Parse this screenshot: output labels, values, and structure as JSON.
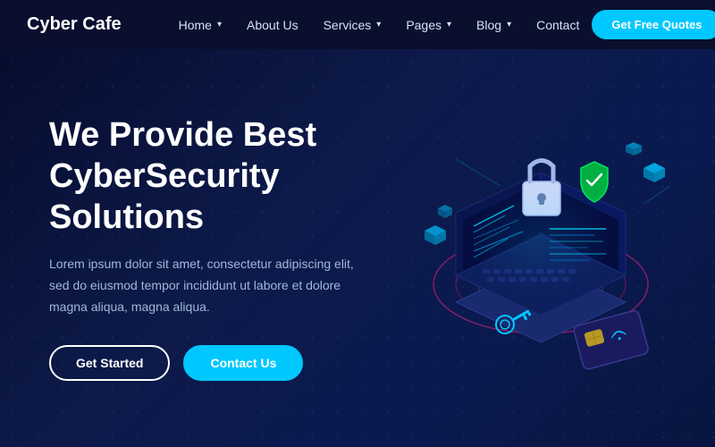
{
  "brand": {
    "name": "Cyber Cafe"
  },
  "navbar": {
    "links": [
      {
        "label": "Home",
        "hasDropdown": true
      },
      {
        "label": "About Us",
        "hasDropdown": false
      },
      {
        "label": "Services",
        "hasDropdown": true
      },
      {
        "label": "Pages",
        "hasDropdown": true
      },
      {
        "label": "Blog",
        "hasDropdown": true
      },
      {
        "label": "Contact",
        "hasDropdown": false
      }
    ],
    "cta_label": "Get Free Quotes"
  },
  "hero": {
    "title_line1": "We Provide Best",
    "title_line2": "CyberSecurity Solutions",
    "description": "Lorem ipsum dolor sit amet, consectetur adipiscing elit, sed do eiusmod tempor incididunt ut labore et dolore magna aliqua, magna aliqua.",
    "btn_start": "Get Started",
    "btn_contact": "Contact Us"
  }
}
